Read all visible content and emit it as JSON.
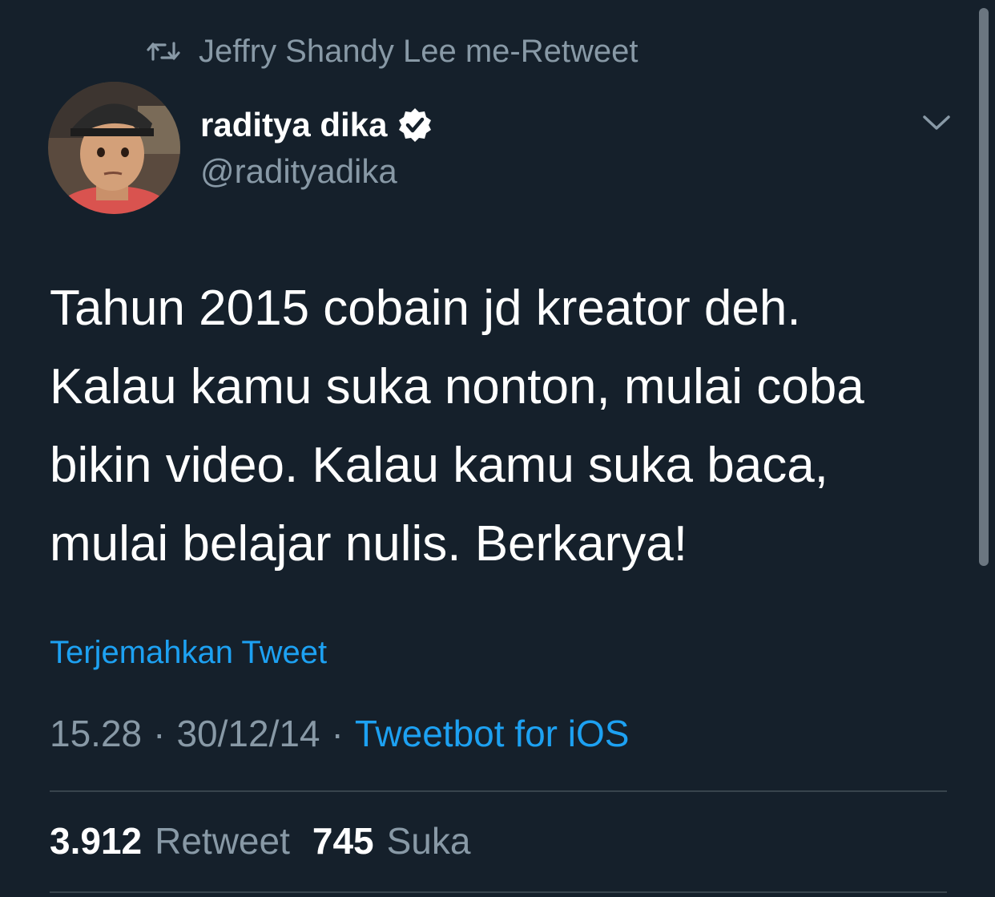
{
  "retweet_context": {
    "icon": "retweet-icon",
    "text": "Jeffry Shandy Lee me-Retweet"
  },
  "author": {
    "display_name": "raditya dika",
    "handle": "@radityadika",
    "verified": true,
    "avatar": "avatar-photo"
  },
  "tweet": {
    "lines": [
      "Tahun 2015 cobain jd kreator deh.",
      "Kalau kamu suka nonton, mulai coba",
      "bikin video. Kalau kamu suka baca,",
      "mulai belajar nulis. Berkarya!"
    ],
    "translate_label": "Terjemahkan Tweet",
    "time": "15.28",
    "separator": "·",
    "date": "30/12/14",
    "source": "Tweetbot for iOS"
  },
  "stats": {
    "retweet_count": "3.912",
    "retweet_label": "Retweet",
    "like_count": "745",
    "like_label": "Suka"
  },
  "colors": {
    "background": "#15202b",
    "secondary_text": "#8899a6",
    "accent": "#1da1f2",
    "divider": "#38444d"
  }
}
